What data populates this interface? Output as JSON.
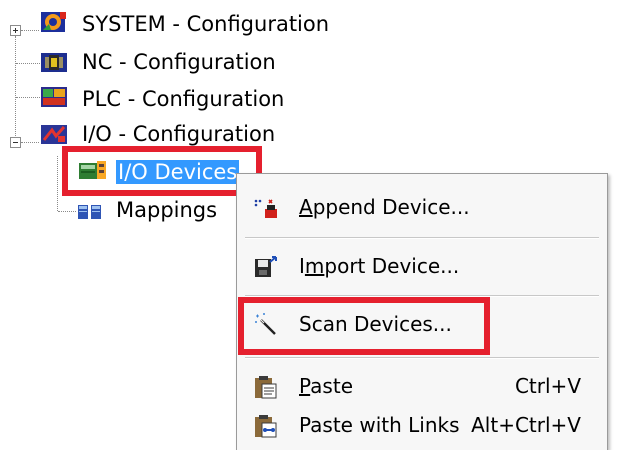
{
  "tree": {
    "items": [
      {
        "label": "SYSTEM - Configuration",
        "icon": "system-config-icon"
      },
      {
        "label": "NC - Configuration",
        "icon": "nc-config-icon"
      },
      {
        "label": "PLC - Configuration",
        "icon": "plc-config-icon"
      },
      {
        "label": "I/O - Configuration",
        "icon": "io-config-icon"
      },
      {
        "label": "I/O Devices",
        "icon": "io-devices-icon",
        "selected": true
      },
      {
        "label": "Mappings",
        "icon": "mappings-icon"
      }
    ]
  },
  "context_menu": {
    "items": [
      {
        "pre": "",
        "mnemonic": "A",
        "post": "ppend Device...",
        "shortcut": "",
        "icon": "append-device-icon"
      },
      {
        "pre": "I",
        "mnemonic": "m",
        "post": "port Device...",
        "shortcut": "",
        "icon": "import-device-icon"
      },
      {
        "pre": "Scan Devices...",
        "mnemonic": "",
        "post": "",
        "shortcut": "",
        "icon": "scan-devices-icon"
      },
      {
        "pre": "",
        "mnemonic": "P",
        "post": "aste",
        "shortcut": "Ctrl+V",
        "icon": "paste-icon"
      },
      {
        "pre": "Paste with Links",
        "mnemonic": "",
        "post": "",
        "shortcut": "Alt+Ctrl+V",
        "icon": "paste-with-links-icon"
      }
    ]
  },
  "colors": {
    "highlight_box": "#e5202e",
    "selection": "#3399ff",
    "menu_background": "#f7f7f7"
  }
}
